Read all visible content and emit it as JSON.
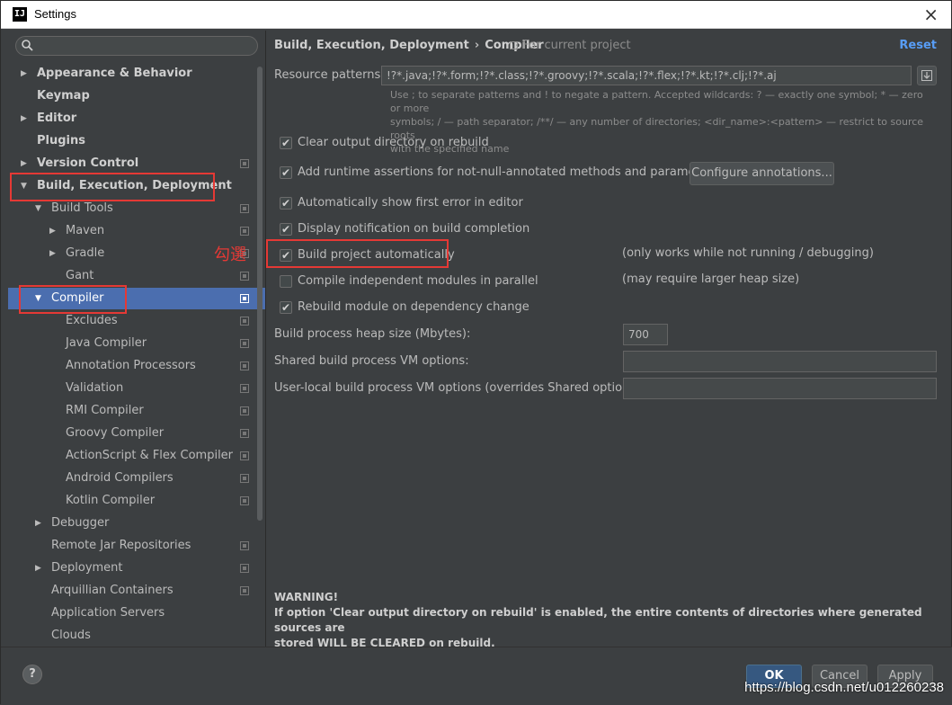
{
  "window": {
    "title": "Settings",
    "app_icon": "IJ",
    "close_glyph": "×"
  },
  "search": {
    "placeholder": ""
  },
  "tree": [
    {
      "label": "Appearance & Behavior",
      "level": 0,
      "arrow": "▶",
      "bold": true,
      "proj": false
    },
    {
      "label": "Keymap",
      "level": 0,
      "arrow": "",
      "bold": true,
      "proj": false
    },
    {
      "label": "Editor",
      "level": 0,
      "arrow": "▶",
      "bold": true,
      "proj": false
    },
    {
      "label": "Plugins",
      "level": 0,
      "arrow": "",
      "bold": true,
      "proj": false
    },
    {
      "label": "Version Control",
      "level": 0,
      "arrow": "▶",
      "bold": true,
      "proj": true
    },
    {
      "label": "Build, Execution, Deployment",
      "level": 0,
      "arrow": "▼",
      "bold": true,
      "proj": false
    },
    {
      "label": "Build Tools",
      "level": 1,
      "arrow": "▼",
      "bold": false,
      "proj": true
    },
    {
      "label": "Maven",
      "level": 2,
      "arrow": "▶",
      "bold": false,
      "proj": true
    },
    {
      "label": "Gradle",
      "level": 2,
      "arrow": "▶",
      "bold": false,
      "proj": true
    },
    {
      "label": "Gant",
      "level": 2,
      "arrow": "",
      "bold": false,
      "proj": true
    },
    {
      "label": "Compiler",
      "level": 1,
      "arrow": "▼",
      "bold": false,
      "proj": true,
      "selected": true
    },
    {
      "label": "Excludes",
      "level": 2,
      "arrow": "",
      "bold": false,
      "proj": true
    },
    {
      "label": "Java Compiler",
      "level": 2,
      "arrow": "",
      "bold": false,
      "proj": true
    },
    {
      "label": "Annotation Processors",
      "level": 2,
      "arrow": "",
      "bold": false,
      "proj": true
    },
    {
      "label": "Validation",
      "level": 2,
      "arrow": "",
      "bold": false,
      "proj": true
    },
    {
      "label": "RMI Compiler",
      "level": 2,
      "arrow": "",
      "bold": false,
      "proj": true
    },
    {
      "label": "Groovy Compiler",
      "level": 2,
      "arrow": "",
      "bold": false,
      "proj": true
    },
    {
      "label": "ActionScript & Flex Compiler",
      "level": 2,
      "arrow": "",
      "bold": false,
      "proj": true
    },
    {
      "label": "Android Compilers",
      "level": 2,
      "arrow": "",
      "bold": false,
      "proj": true
    },
    {
      "label": "Kotlin Compiler",
      "level": 2,
      "arrow": "",
      "bold": false,
      "proj": true
    },
    {
      "label": "Debugger",
      "level": 1,
      "arrow": "▶",
      "bold": false,
      "proj": false
    },
    {
      "label": "Remote Jar Repositories",
      "level": 1,
      "arrow": "",
      "bold": false,
      "proj": true
    },
    {
      "label": "Deployment",
      "level": 1,
      "arrow": "▶",
      "bold": false,
      "proj": true
    },
    {
      "label": "Arquillian Containers",
      "level": 1,
      "arrow": "",
      "bold": false,
      "proj": true
    },
    {
      "label": "Application Servers",
      "level": 1,
      "arrow": "",
      "bold": false,
      "proj": false
    },
    {
      "label": "Clouds",
      "level": 1,
      "arrow": "",
      "bold": false,
      "proj": false
    }
  ],
  "header": {
    "crumb_parent": "Build, Execution, Deployment",
    "crumb_sep": "›",
    "crumb_current": "Compiler",
    "scope": "For current project",
    "reset": "Reset"
  },
  "resource": {
    "label": "Resource patterns:",
    "value": "!?*.java;!?*.form;!?*.class;!?*.groovy;!?*.scala;!?*.flex;!?*.kt;!?*.clj;!?*.aj",
    "help_1": "Use ; to separate patterns and ! to negate a pattern. Accepted wildcards: ? — exactly one symbol; * — zero or more",
    "help_2": "symbols; / — path separator; /**/ — any number of directories; <dir_name>:<pattern> — restrict to source roots",
    "help_3": "with the specified name"
  },
  "checkboxes": [
    {
      "label": "Clear output directory on rebuild",
      "checked": true
    },
    {
      "label": "Add runtime assertions for not-null-annotated methods and parameters",
      "checked": true
    },
    {
      "label": "Automatically show first error in editor",
      "checked": true
    },
    {
      "label": "Display notification on build completion",
      "checked": true
    },
    {
      "label": "Build project automatically",
      "checked": true
    },
    {
      "label": "Compile independent modules in parallel",
      "checked": false
    },
    {
      "label": "Rebuild module on dependency change",
      "checked": true
    }
  ],
  "configure_button": "Configure annotations...",
  "notes": {
    "build_auto": "(only works while not running / debugging)",
    "parallel": "(may require larger heap size)"
  },
  "heap": {
    "label": "Build process heap size (Mbytes):",
    "value": "700"
  },
  "shared_vm": {
    "label": "Shared build process VM options:",
    "value": ""
  },
  "user_vm": {
    "label": "User-local build process VM options (overrides Shared options):",
    "value": ""
  },
  "warning": {
    "title": "WARNING!",
    "line1": "If option 'Clear output directory on rebuild' is enabled, the entire contents of directories where generated sources are",
    "line2": "stored WILL BE CLEARED on rebuild."
  },
  "annotation": "勾選",
  "buttons": {
    "ok": "OK",
    "cancel": "Cancel",
    "apply": "Apply",
    "help": "?"
  },
  "watermark": "https://blog.csdn.net/u012260238",
  "colors": {
    "accent": "#4b6eaf",
    "link": "#589df6",
    "annotation_red": "#e53935"
  }
}
